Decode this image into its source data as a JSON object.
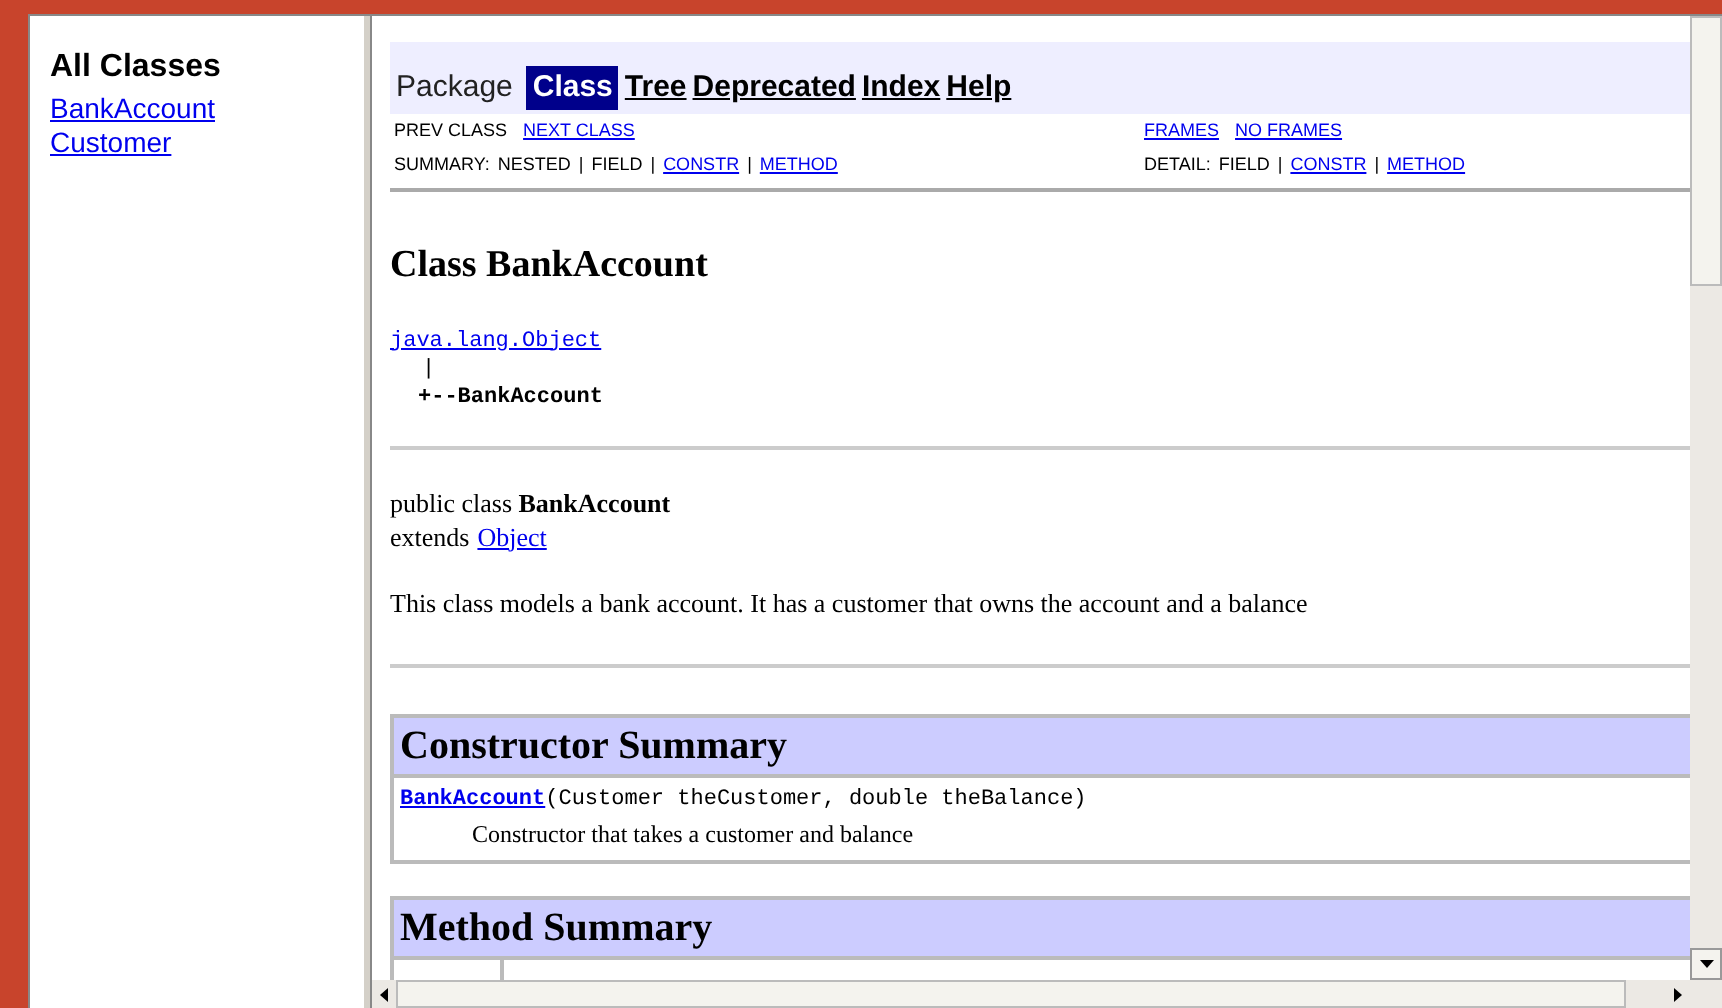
{
  "sidebar": {
    "title": "All Classes",
    "items": [
      {
        "label": "BankAccount"
      },
      {
        "label": "Customer"
      }
    ]
  },
  "navbar": {
    "items": [
      {
        "label": "Package",
        "kind": "plain",
        "selected": false
      },
      {
        "label": "Class",
        "kind": "link",
        "selected": true
      },
      {
        "label": "Tree",
        "kind": "link",
        "selected": false
      },
      {
        "label": "Deprecated",
        "kind": "link",
        "selected": false
      },
      {
        "label": "Index",
        "kind": "link",
        "selected": false
      },
      {
        "label": "Help",
        "kind": "link",
        "selected": false
      }
    ]
  },
  "subnav": {
    "left_top": [
      {
        "label": "PREV CLASS",
        "kind": "plain"
      },
      {
        "label": "NEXT CLASS",
        "kind": "link"
      }
    ],
    "right_top": [
      {
        "label": "FRAMES",
        "kind": "link"
      },
      {
        "label": "NO FRAMES",
        "kind": "link"
      }
    ],
    "summary_label": "SUMMARY:",
    "summary": [
      {
        "label": "NESTED",
        "kind": "plain"
      },
      {
        "label": "FIELD",
        "kind": "plain"
      },
      {
        "label": "CONSTR",
        "kind": "link"
      },
      {
        "label": "METHOD",
        "kind": "link"
      }
    ],
    "detail_label": "DETAIL:",
    "detail": [
      {
        "label": "FIELD",
        "kind": "plain"
      },
      {
        "label": "CONSTR",
        "kind": "link"
      },
      {
        "label": "METHOD",
        "kind": "link"
      }
    ],
    "separator": "|"
  },
  "class_title": "Class BankAccount",
  "hierarchy": {
    "parent": "java.lang.Object",
    "bar": "|",
    "child": "+--BankAccount"
  },
  "declaration": {
    "line1": "public class **BankAccount**",
    "extends": "extends",
    "parent_link": "Object"
  },
  "description": "This class models a bank account. It has a customer that owns the account and a balance",
  "constructor_summary": {
    "title": "Constructor Summary",
    "rows": [
      {
        "name": "BankAccount",
        "params": "(Customer theCustomer, double theBalance)",
        "description": "Constructor that takes a customer and balance"
      }
    ]
  },
  "method_summary": {
    "title": "Method Summary"
  }
}
